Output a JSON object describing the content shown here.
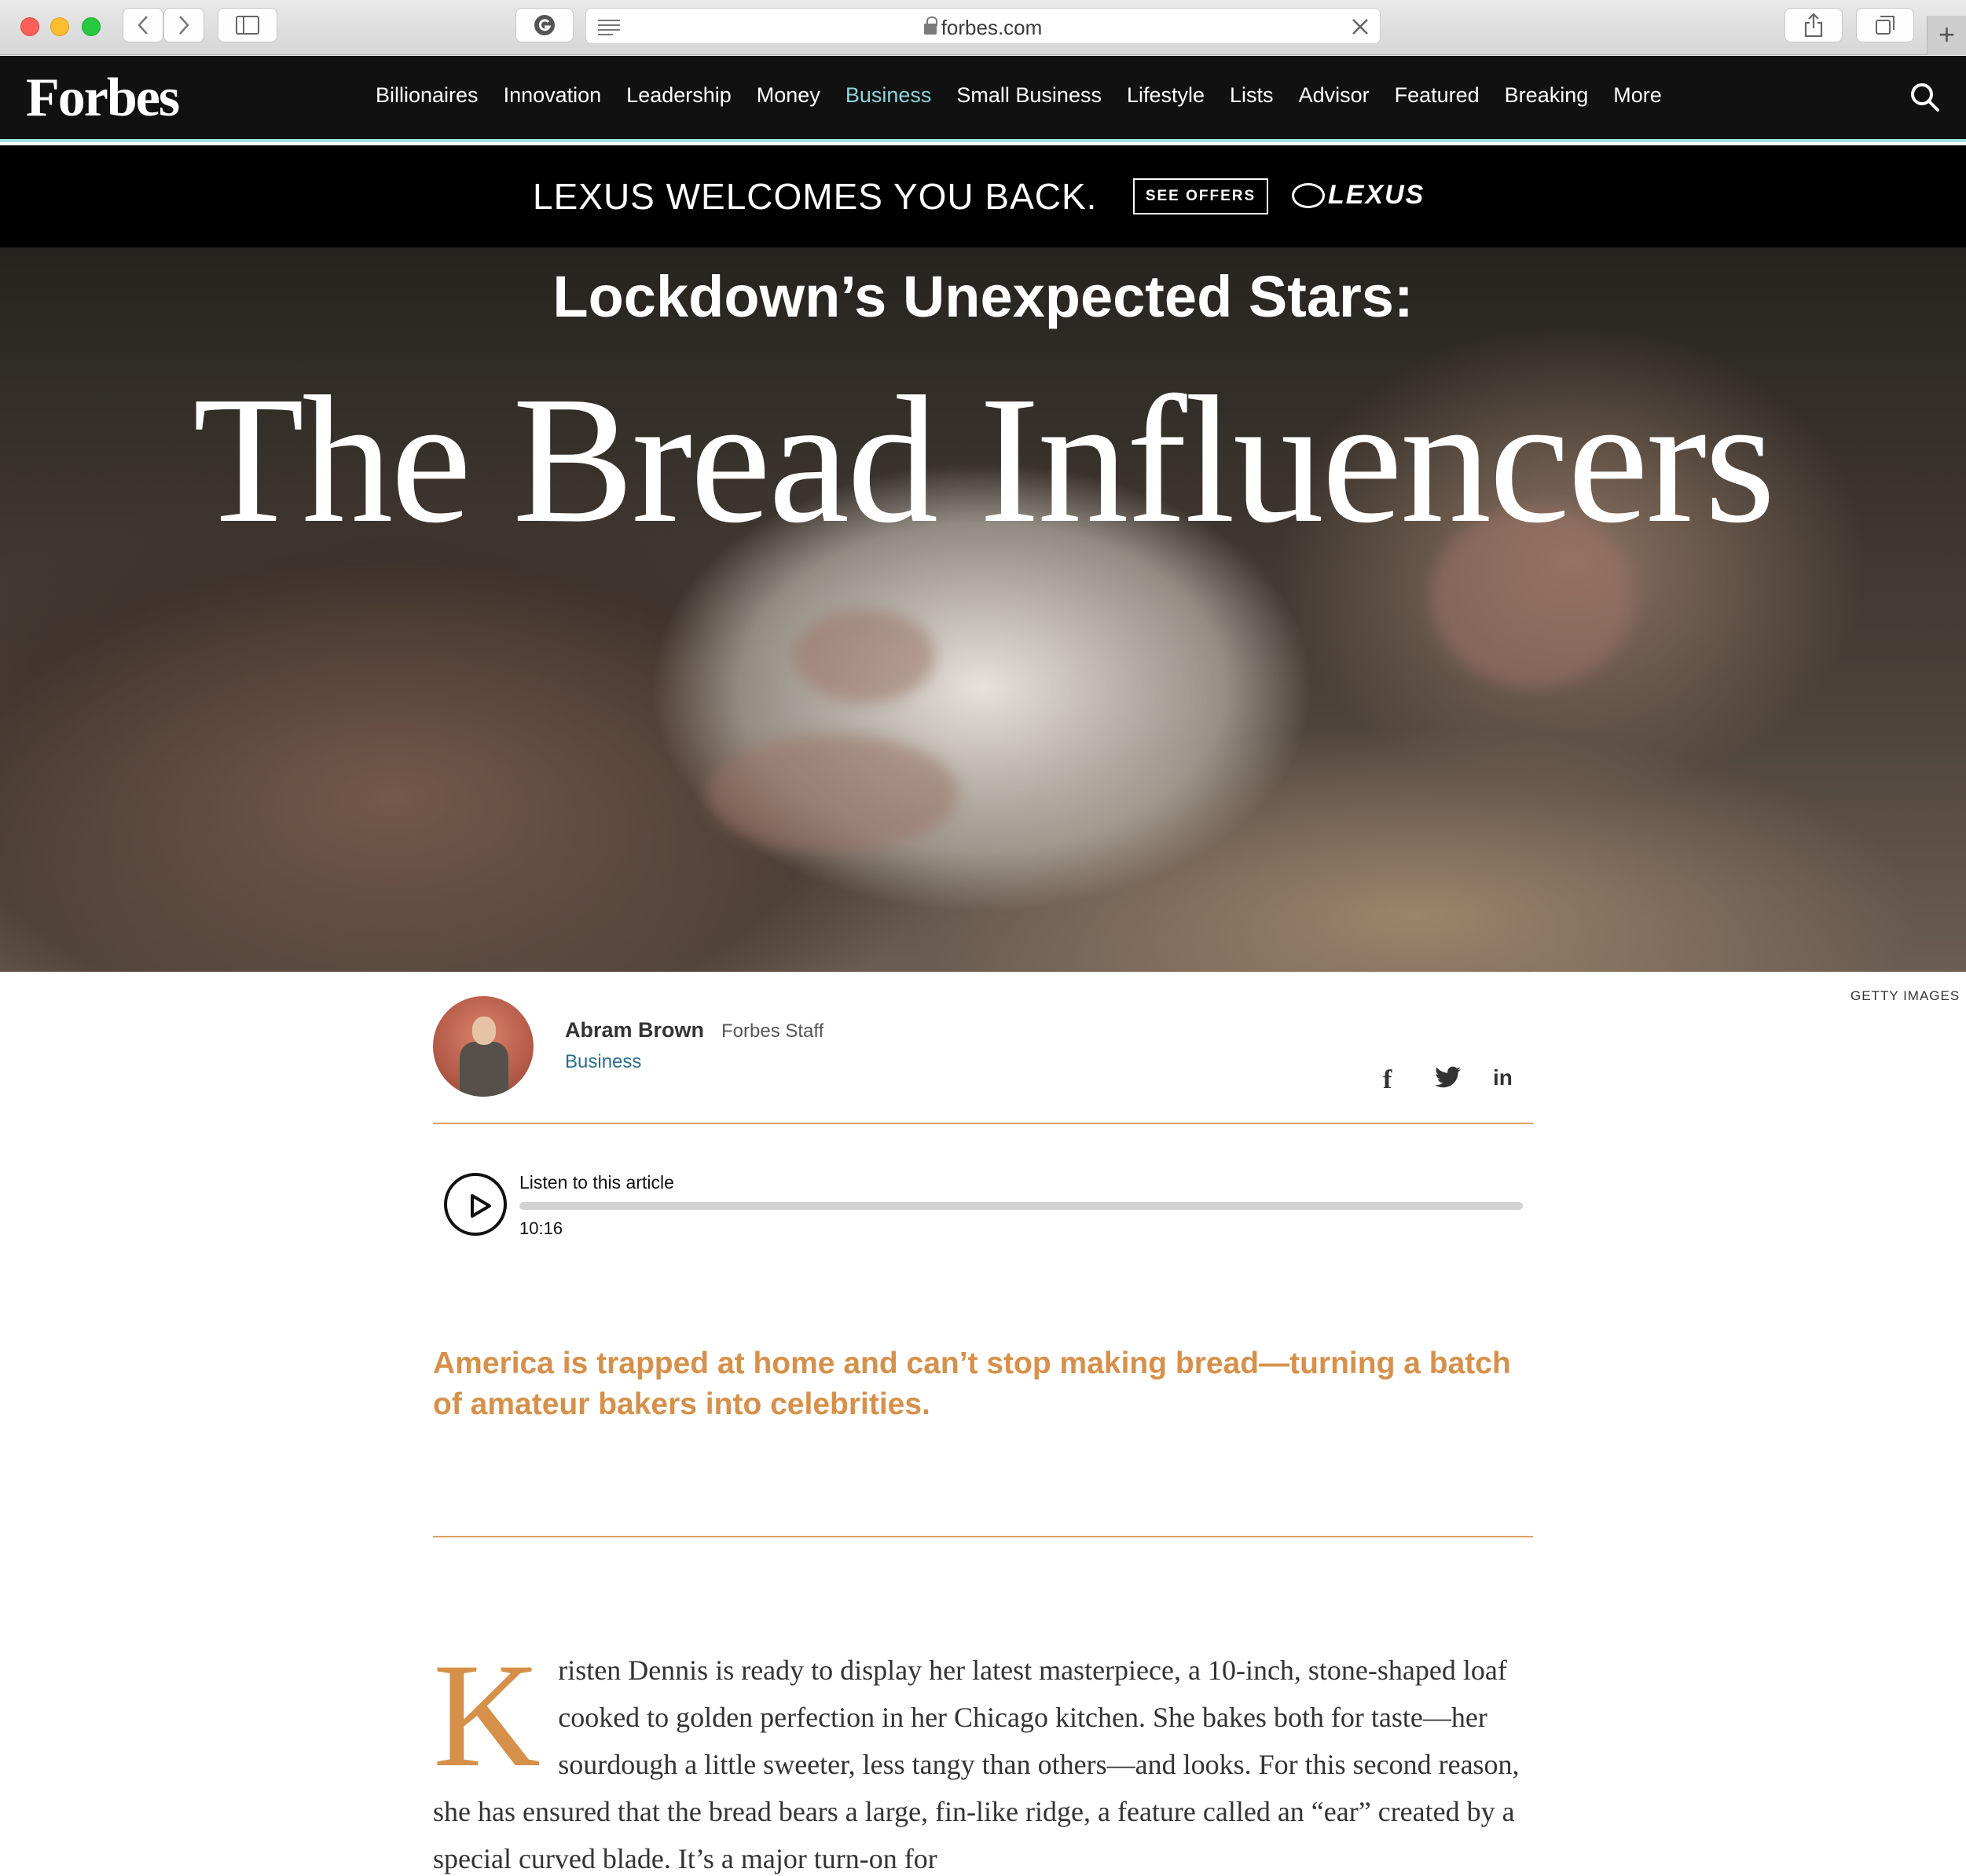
{
  "browser": {
    "url": "forbes.com"
  },
  "nav": {
    "logo": "Forbes",
    "items": [
      "Billionaires",
      "Innovation",
      "Leadership",
      "Money",
      "Business",
      "Small Business",
      "Lifestyle",
      "Lists",
      "Advisor",
      "Featured",
      "Breaking",
      "More"
    ],
    "active": "Business",
    "accent_color": "#9ee0df"
  },
  "ad": {
    "headline": "LEXUS WELCOMES YOU BACK.",
    "cta": "SEE OFFERS",
    "brand": "LEXUS"
  },
  "hero": {
    "kicker": "Lockdown’s Unexpected Stars:",
    "title": "The Bread Influencers",
    "credit": "GETTY IMAGES"
  },
  "author": {
    "name": "Abram Brown",
    "role": "Forbes Staff",
    "category": "Business"
  },
  "share": {
    "facebook": "f",
    "twitter": "twitter-icon",
    "linkedin": "in"
  },
  "audio": {
    "label": "Listen to this article",
    "duration": "10:16",
    "progress": 0
  },
  "article": {
    "dek": "America is trapped at home and can’t stop making bread—turning a batch of amateur bakers into celebrities.",
    "drop_cap": "K",
    "first_paragraph": "risten Dennis is ready to display her latest masterpiece, a 10-inch, stone-shaped loaf cooked to golden perfection in her Chicago kitchen. She bakes both for taste—her sourdough a little sweeter, less tangy than others—and looks. For this second reason, she has ensured that the bread bears a large, fin-like ridge, a feature called an “ear” created by a special curved blade. It’s a major turn-on for",
    "accent_color": "#d6904a"
  }
}
